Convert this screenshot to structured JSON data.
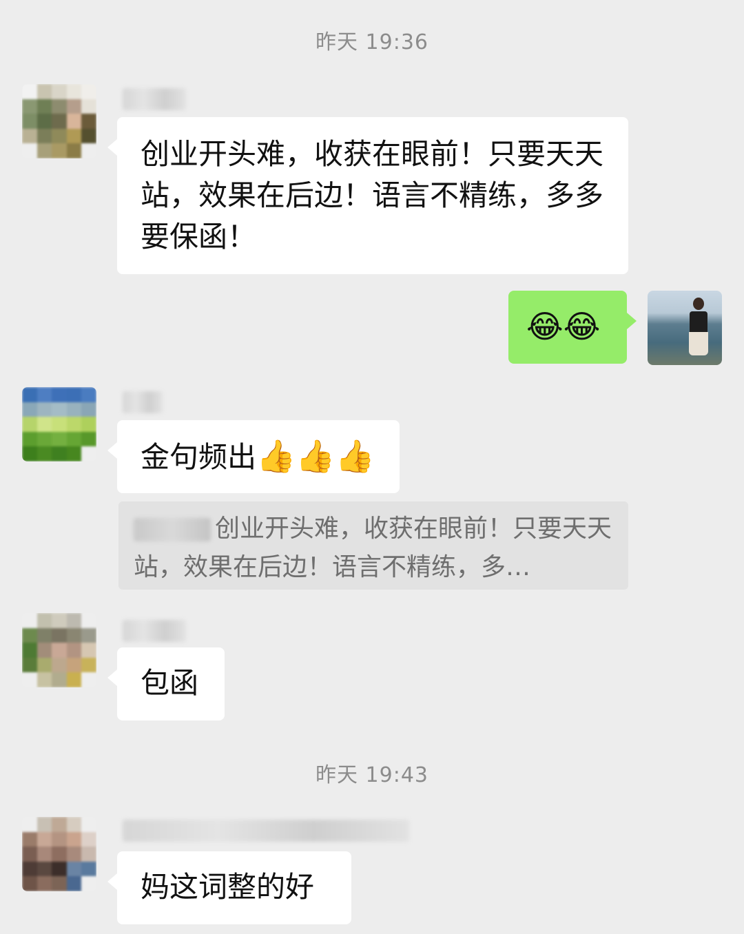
{
  "chat": {
    "timestamps": [
      "昨天 19:36",
      "昨天 19:43"
    ],
    "messages": [
      {
        "side": "left",
        "text": "创业开头难，收获在眼前！只要天天站，效果在后边！语言不精练，多多要保函！"
      },
      {
        "side": "right",
        "emoji": [
          "😂",
          "😂"
        ]
      },
      {
        "side": "left",
        "text": "金句频出",
        "emoji": [
          "👍",
          "👍",
          "👍"
        ],
        "quote": "创业开头难，收获在眼前！只要天天站，效果在后边！语言不精练，多…"
      },
      {
        "side": "left",
        "text": "包函"
      },
      {
        "side": "left",
        "text": "妈这词整的好"
      }
    ]
  },
  "colors": {
    "background": "#ededed",
    "bubble_left": "#ffffff",
    "bubble_right": "#95ec69",
    "quote_bg": "#e2e2e2",
    "timestamp_text": "#8c8c8c"
  },
  "icons": {
    "emoji_self": "face-with-tears-of-joy",
    "emoji_reply": "thumbs-up"
  }
}
